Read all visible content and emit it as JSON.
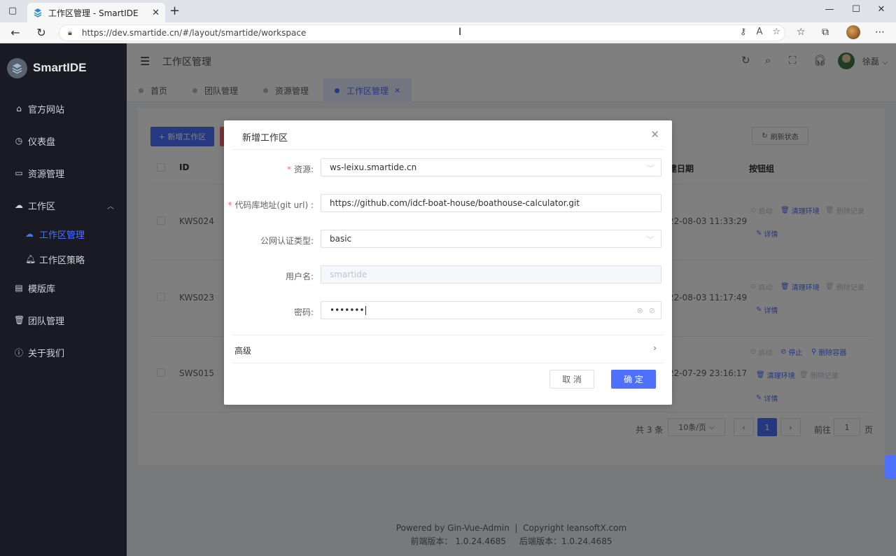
{
  "browser": {
    "tab_title": "工作区管理 - SmartIDE",
    "url_host": "https://dev.smartide.cn",
    "url_path": "/#/layout/smartide/workspace"
  },
  "sidebar": {
    "logo_text": "SmartIDE",
    "items": [
      {
        "label": "官方网站",
        "icon": "home-icon"
      },
      {
        "label": "仪表盘",
        "icon": "dashboard-icon"
      },
      {
        "label": "资源管理",
        "icon": "monitor-icon"
      },
      {
        "label": "工作区",
        "icon": "cloud-icon"
      },
      {
        "label": "模版库",
        "icon": "template-icon"
      },
      {
        "label": "团队管理",
        "icon": "trash-icon"
      },
      {
        "label": "关于我们",
        "icon": "info-icon"
      }
    ],
    "subitems": [
      {
        "label": "工作区管理",
        "icon": "cloud-icon",
        "active": true
      },
      {
        "label": "工作区策略",
        "icon": "bell-icon",
        "active": false
      }
    ]
  },
  "header": {
    "title": "工作区管理",
    "user_name": "徐磊"
  },
  "tags": [
    {
      "label": "首页"
    },
    {
      "label": "团队管理"
    },
    {
      "label": "资源管理"
    },
    {
      "label": "工作区管理",
      "active": true
    }
  ],
  "toolbar": {
    "new_label": "+ 新增工作区",
    "refresh_label": "刷新状态"
  },
  "table": {
    "headers": {
      "id": "ID",
      "date": "建日期",
      "ops": "按钮组"
    },
    "rows": [
      {
        "id": "KWS024",
        "date": "22-08-03 11:33:29"
      },
      {
        "id": "KWS023",
        "date": "22-08-03 11:17:49"
      },
      {
        "id": "SWS015",
        "date": "22-07-29 23:16:17"
      }
    ],
    "ops": {
      "start": "启动",
      "clean": "清理环境",
      "delete_record": "删除记录",
      "detail": "详情",
      "stop": "停止",
      "delete_container": "删除容器"
    }
  },
  "pagination": {
    "total": "共 3 条",
    "page_size": "10条/页",
    "current": "1",
    "goto_label": "前往",
    "goto_value": "1",
    "page_suffix": "页"
  },
  "footer": {
    "line1_left": "Powered by  Gin-Vue-Admin",
    "line1_right": "Copyright  leansoftX.com",
    "line2_left": "前端版本：  1.0.24.4685",
    "line2_right": "后端版本：1.0.24.4685"
  },
  "dialog": {
    "title": "新增工作区",
    "fields": {
      "resource_label": "资源:",
      "resource_value": "ws-leixu.smartide.cn",
      "git_label": "代码库地址(git url) :",
      "git_value": "https://github.com/idcf-boat-house/boathouse-calculator.git",
      "auth_label": "公网认证类型:",
      "auth_value": "basic",
      "user_label": "用户名:",
      "user_placeholder": "smartide",
      "pwd_label": "密码:",
      "pwd_value": "•••••••"
    },
    "advanced_label": "高级",
    "cancel_label": "取 消",
    "ok_label": "确 定"
  },
  "colors": {
    "accent": "#4d70ff",
    "sidebar_bg": "#191a23",
    "danger": "#f56c6c"
  }
}
